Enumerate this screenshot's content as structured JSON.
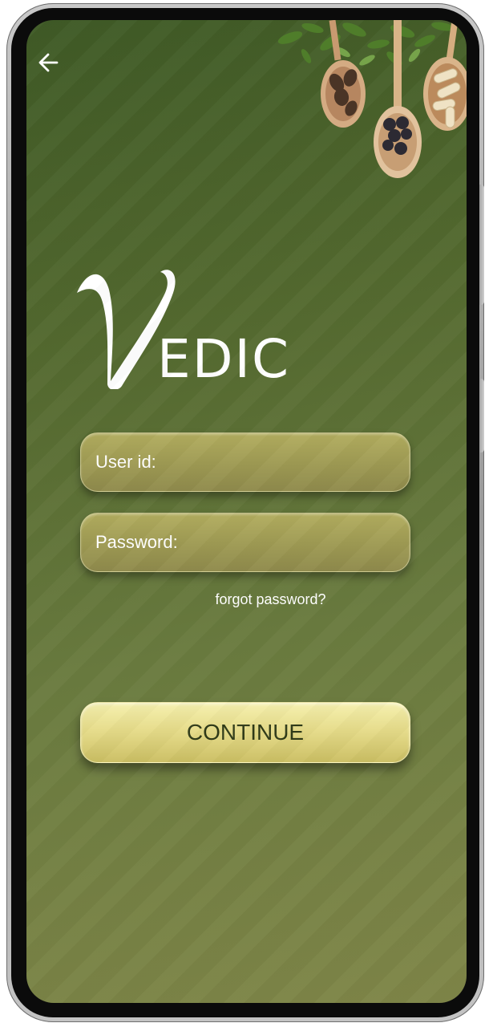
{
  "app": {
    "logo_text": "EDIC",
    "logo_letter": "V"
  },
  "nav": {
    "back_icon": "arrow-left-icon"
  },
  "login": {
    "user_placeholder": "User id:",
    "user_value": "",
    "password_placeholder": "Password:",
    "password_value": "",
    "forgot_label": "forgot password?",
    "continue_label": "CONTINUE"
  },
  "colors": {
    "background": "#53692f",
    "field": "#a39f56",
    "button": "#e6dc8a",
    "button_text": "#2f3a18"
  },
  "decor": {
    "corner_image": "herbal-spoons-image"
  }
}
